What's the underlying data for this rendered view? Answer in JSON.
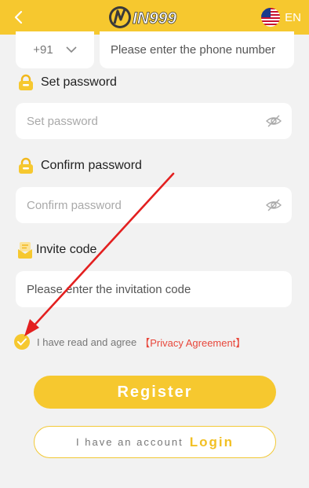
{
  "header": {
    "logo_text": "IN999",
    "language": "EN",
    "back_icon": "chevron-left-icon",
    "flag_icon": "us-flag-icon"
  },
  "phone": {
    "country_code": "+91",
    "placeholder": "Please enter the phone number"
  },
  "set_password": {
    "label": "Set password",
    "placeholder": "Set password",
    "icon": "lock-icon"
  },
  "confirm_password": {
    "label": "Confirm password",
    "placeholder": "Confirm password",
    "icon": "lock-icon"
  },
  "invite": {
    "label": "Invite code",
    "placeholder": "Please enter the invitation code",
    "icon": "invite-icon"
  },
  "agreement": {
    "text": "I have read and agree",
    "link": "【Privacy Agreement】",
    "checked": true
  },
  "buttons": {
    "register": "Register",
    "login_prefix": "I have an account",
    "login": "Login"
  },
  "colors": {
    "brand_yellow": "#f6c82f",
    "background": "#f2f2f2",
    "link_red": "#e8473b",
    "annotation_arrow": "#e32020"
  }
}
